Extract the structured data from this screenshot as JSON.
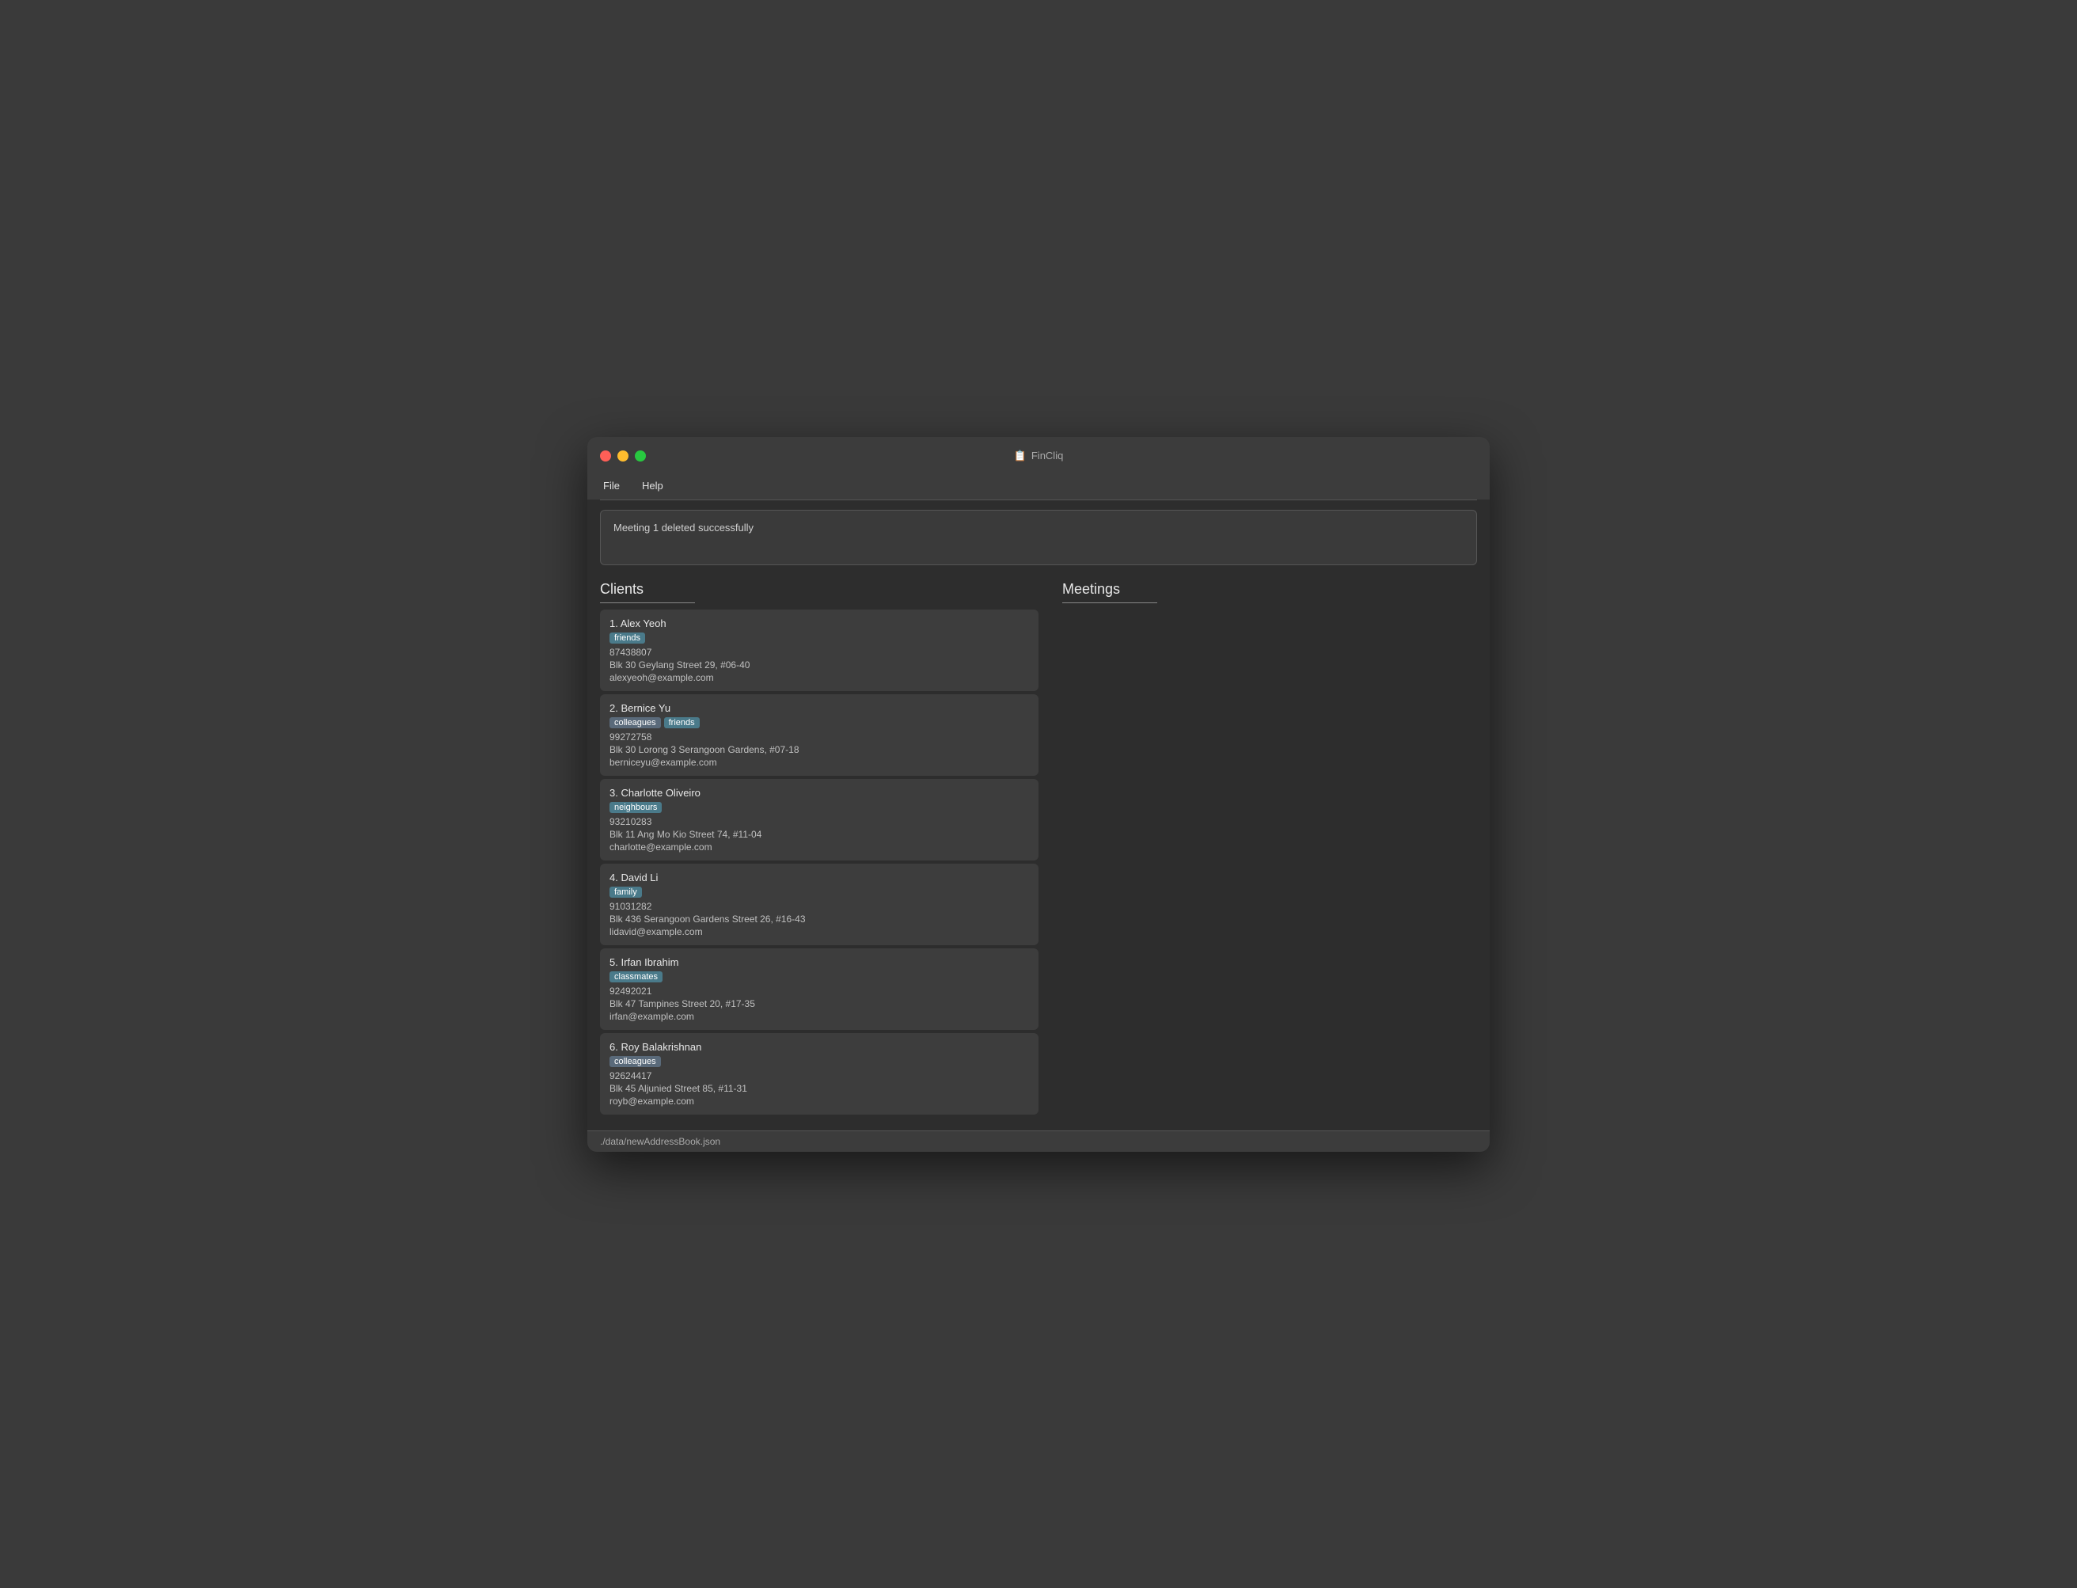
{
  "window": {
    "title": "FinCliq"
  },
  "menubar": {
    "items": [
      "File",
      "Help"
    ]
  },
  "notification": {
    "text": "Meeting 1 deleted successfully"
  },
  "clients_panel": {
    "header": "Clients"
  },
  "meetings_panel": {
    "header": "Meetings"
  },
  "clients": [
    {
      "number": "1.",
      "name": "Alex Yeoh",
      "tags": [
        "friends"
      ],
      "phone": "87438807",
      "address": "Blk 30 Geylang Street 29, #06-40",
      "email": "alexyeoh@example.com"
    },
    {
      "number": "2.",
      "name": "Bernice Yu",
      "tags": [
        "colleagues",
        "friends"
      ],
      "phone": "99272758",
      "address": "Blk 30 Lorong 3 Serangoon Gardens, #07-18",
      "email": "berniceyu@example.com"
    },
    {
      "number": "3.",
      "name": "Charlotte Oliveiro",
      "tags": [
        "neighbours"
      ],
      "phone": "93210283",
      "address": "Blk 11 Ang Mo Kio Street 74, #11-04",
      "email": "charlotte@example.com"
    },
    {
      "number": "4.",
      "name": "David Li",
      "tags": [
        "family"
      ],
      "phone": "91031282",
      "address": "Blk 436 Serangoon Gardens Street 26, #16-43",
      "email": "lidavid@example.com"
    },
    {
      "number": "5.",
      "name": "Irfan Ibrahim",
      "tags": [
        "classmates"
      ],
      "phone": "92492021",
      "address": "Blk 47 Tampines Street 20, #17-35",
      "email": "irfan@example.com"
    },
    {
      "number": "6.",
      "name": "Roy Balakrishnan",
      "tags": [
        "colleagues"
      ],
      "phone": "92624417",
      "address": "Blk 45 Aljunied Street 85, #11-31",
      "email": "royb@example.com"
    }
  ],
  "statusbar": {
    "text": "./data/newAddressBook.json"
  },
  "tag_classes": {
    "friends": "tag-friends",
    "colleagues": "tag-colleagues",
    "neighbours": "tag-neighbours",
    "family": "tag-family",
    "classmates": "tag-classmates"
  }
}
